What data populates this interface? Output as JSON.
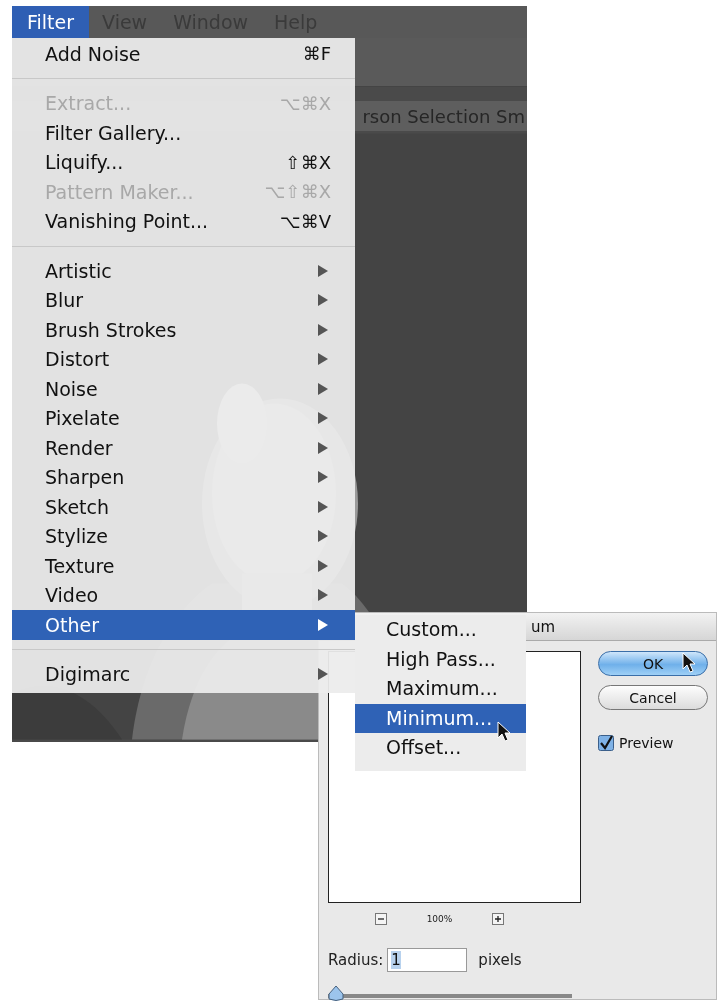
{
  "app_backdrop": {
    "kind": "picture",
    "document_title": "rson Selection Sm"
  },
  "menu_bar": {
    "items": [
      {
        "label": "Filter",
        "selected": true
      },
      {
        "label": "View",
        "selected": false
      },
      {
        "label": "Window",
        "selected": false
      },
      {
        "label": "Help",
        "selected": false
      }
    ]
  },
  "filter_menu": {
    "items": [
      {
        "kind": "item",
        "label": "Add Noise",
        "shortcut": "⌘F",
        "disabled": false
      },
      {
        "kind": "separator"
      },
      {
        "kind": "item",
        "label": "Extract...",
        "shortcut": "⌥⌘X",
        "disabled": true
      },
      {
        "kind": "item",
        "label": "Filter Gallery...",
        "disabled": false
      },
      {
        "kind": "item",
        "label": "Liquify...",
        "shortcut": "⇧⌘X",
        "disabled": false
      },
      {
        "kind": "item",
        "label": "Pattern Maker...",
        "shortcut": "⌥⇧⌘X",
        "disabled": true
      },
      {
        "kind": "item",
        "label": "Vanishing Point...",
        "shortcut": "⌥⌘V",
        "disabled": false
      },
      {
        "kind": "separator"
      },
      {
        "kind": "submenu",
        "label": "Artistic",
        "selected": false
      },
      {
        "kind": "submenu",
        "label": "Blur",
        "selected": false
      },
      {
        "kind": "submenu",
        "label": "Brush Strokes",
        "selected": false
      },
      {
        "kind": "submenu",
        "label": "Distort",
        "selected": false
      },
      {
        "kind": "submenu",
        "label": "Noise",
        "selected": false
      },
      {
        "kind": "submenu",
        "label": "Pixelate",
        "selected": false
      },
      {
        "kind": "submenu",
        "label": "Render",
        "selected": false
      },
      {
        "kind": "submenu",
        "label": "Sharpen",
        "selected": false
      },
      {
        "kind": "submenu",
        "label": "Sketch",
        "selected": false
      },
      {
        "kind": "submenu",
        "label": "Stylize",
        "selected": false
      },
      {
        "kind": "submenu",
        "label": "Texture",
        "selected": false
      },
      {
        "kind": "submenu",
        "label": "Video",
        "selected": false
      },
      {
        "kind": "submenu",
        "label": "Other",
        "selected": true
      },
      {
        "kind": "separator"
      },
      {
        "kind": "submenu",
        "label": "Digimarc",
        "selected": false
      }
    ]
  },
  "other_submenu": {
    "items": [
      {
        "label": "Custom...",
        "selected": false
      },
      {
        "label": "High Pass...",
        "selected": false
      },
      {
        "label": "Maximum...",
        "selected": false
      },
      {
        "label": "Minimum...",
        "selected": true
      },
      {
        "label": "Offset...",
        "selected": false
      }
    ]
  },
  "dialog": {
    "title": "um",
    "zoom_level": "100%",
    "radius_label": "Radius:",
    "radius_value": "1",
    "radius_unit": "pixels",
    "radius_slider": {
      "level": 0
    },
    "buttons": [
      {
        "label": "OK",
        "default": true
      },
      {
        "label": "Cancel",
        "default": false
      }
    ],
    "preview": {
      "label": "Preview",
      "checked": true
    }
  }
}
